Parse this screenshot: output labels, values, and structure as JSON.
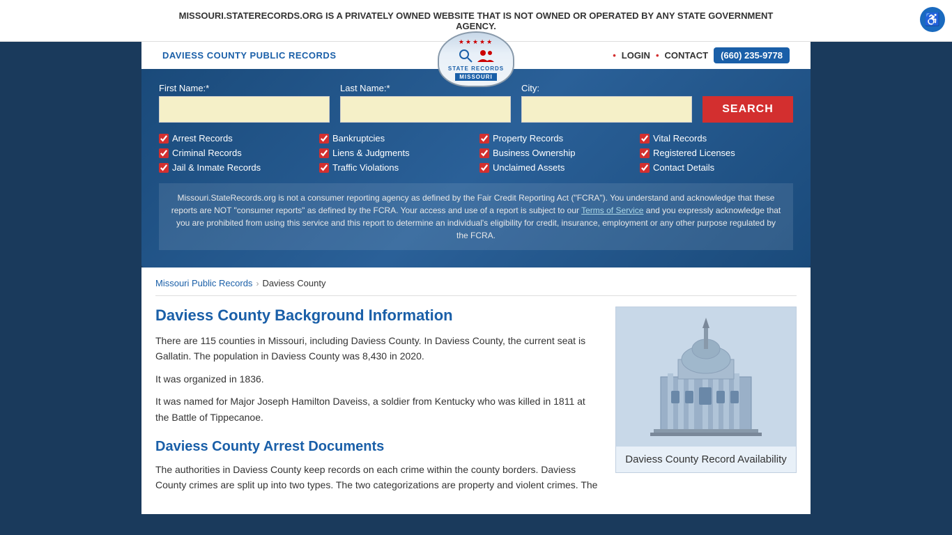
{
  "banner": {
    "text": "MISSOURI.STATERECORDS.ORG IS A PRIVATELY OWNED WEBSITE THAT IS NOT OWNED OR OPERATED BY ANY STATE GOVERNMENT AGENCY.",
    "close_label": "×"
  },
  "accessibility": {
    "label": "♿"
  },
  "header": {
    "site_title": "DAVIESS COUNTY PUBLIC RECORDS",
    "logo_text": "STATE RECORDS\nMISSOURI",
    "nav": {
      "login": "LOGIN",
      "contact": "CONTACT",
      "phone": "(660) 235-9778",
      "bullet": "•"
    }
  },
  "search": {
    "first_name_label": "First Name:*",
    "last_name_label": "Last Name:*",
    "city_label": "City:",
    "first_name_placeholder": "",
    "last_name_placeholder": "",
    "city_placeholder": "",
    "button_label": "SEARCH"
  },
  "checkboxes": [
    {
      "label": "Arrest Records",
      "checked": true
    },
    {
      "label": "Bankruptcies",
      "checked": true
    },
    {
      "label": "Property Records",
      "checked": true
    },
    {
      "label": "Vital Records",
      "checked": true
    },
    {
      "label": "Criminal Records",
      "checked": true
    },
    {
      "label": "Liens & Judgments",
      "checked": true
    },
    {
      "label": "Business Ownership",
      "checked": true
    },
    {
      "label": "Registered Licenses",
      "checked": true
    },
    {
      "label": "Jail & Inmate Records",
      "checked": true
    },
    {
      "label": "Traffic Violations",
      "checked": true
    },
    {
      "label": "Unclaimed Assets",
      "checked": true
    },
    {
      "label": "Contact Details",
      "checked": true
    }
  ],
  "disclaimer": {
    "text_before_link": "Missouri.StateRecords.org is not a consumer reporting agency as defined by the Fair Credit Reporting Act (\"FCRA\"). You understand and acknowledge that these reports are NOT \"consumer reports\" as defined by the FCRA. Your access and use of a report is subject to our ",
    "link_text": "Terms of Service",
    "text_after_link": " and you expressly acknowledge that you are prohibited from using this service and this report to determine an individual's eligibility for credit, insurance, employment or any other purpose regulated by the FCRA."
  },
  "breadcrumb": {
    "home": "Missouri Public Records",
    "current": "Daviess County"
  },
  "main_content": {
    "background_heading": "Daviess County Background Information",
    "background_para1": "There are 115 counties in Missouri, including Daviess County. In Daviess County, the current seat is Gallatin. The population in Daviess County was 8,430 in 2020.",
    "background_para2": "It was organized in 1836.",
    "background_para3": "It was named for Major Joseph Hamilton Daveiss, a soldier from Kentucky who was killed in 1811 at the Battle of Tippecanoe.",
    "arrest_heading": "Daviess County Arrest Documents",
    "arrest_para1": "The authorities in Daviess County keep records on each crime within the county borders. Daviess County crimes are split up into two types. The two categorizations are property and violent crimes. The"
  },
  "card": {
    "title": "Daviess County Record Availability"
  }
}
